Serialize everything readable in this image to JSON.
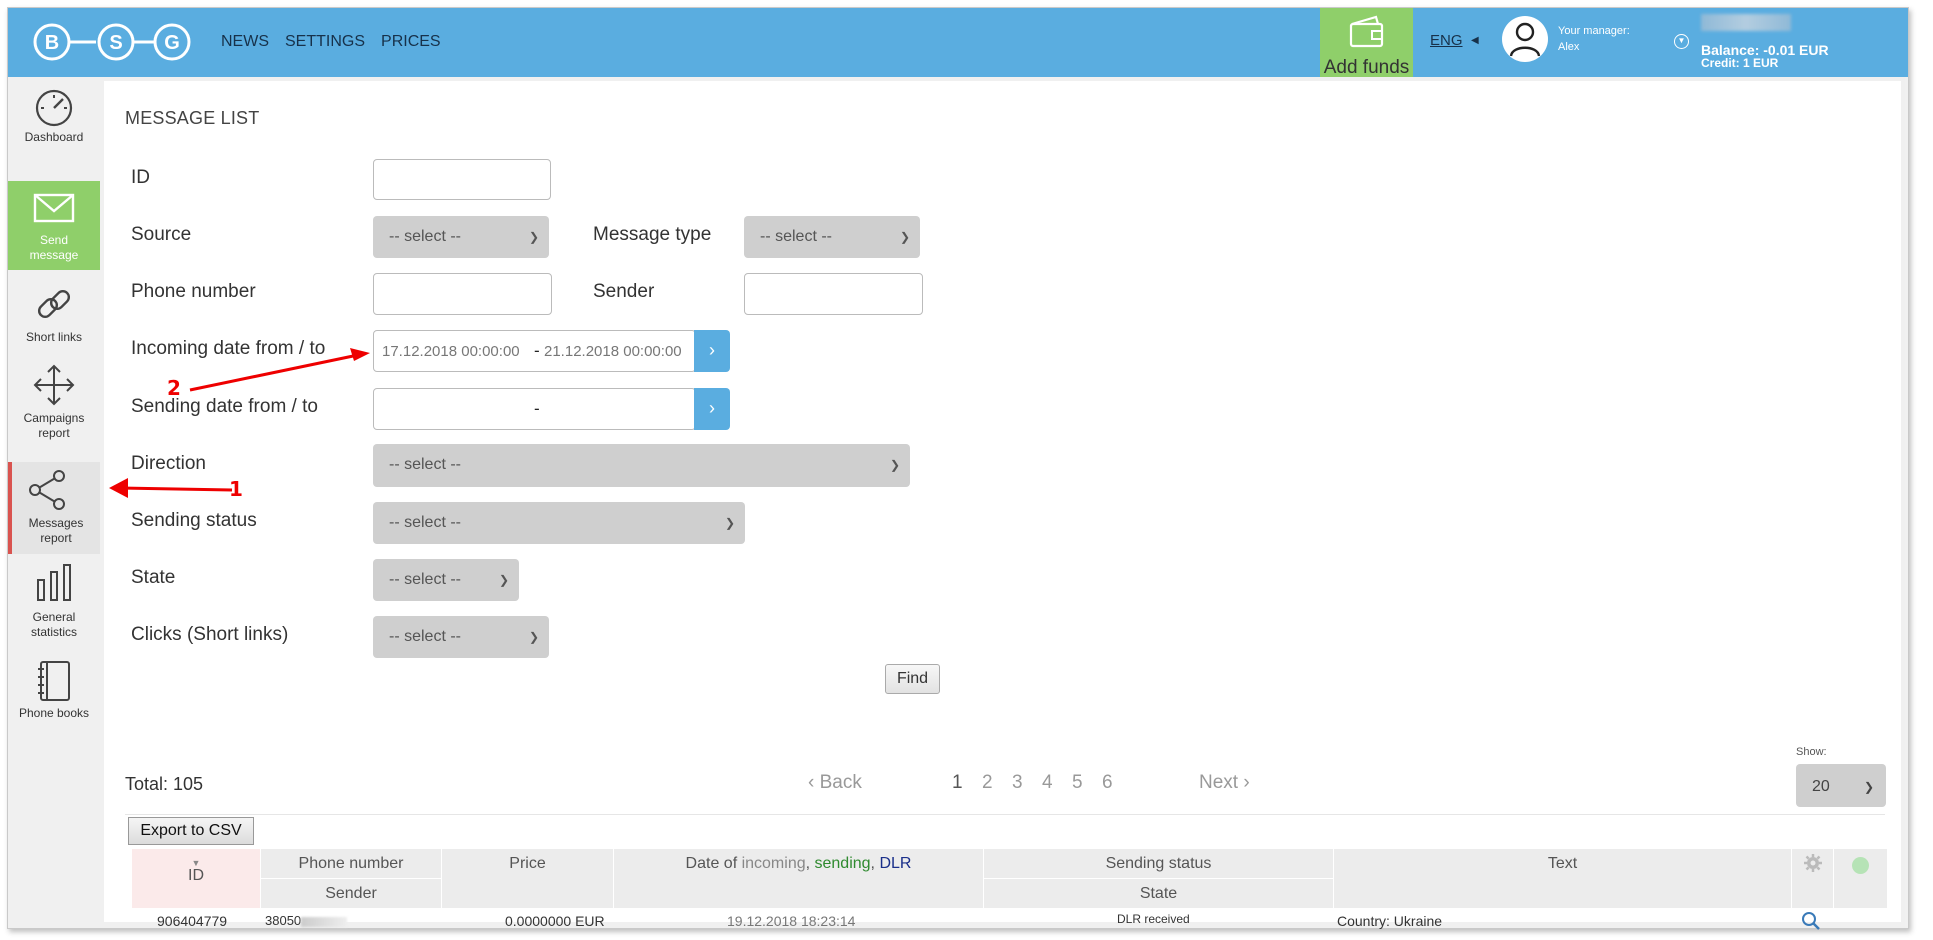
{
  "header": {
    "logo": {
      "letters": [
        "B",
        "S",
        "G"
      ]
    },
    "nav": [
      "NEWS",
      "SETTINGS",
      "PRICES"
    ],
    "add_funds": "Add funds",
    "language": "ENG",
    "manager_label": "Your manager:",
    "manager_name": "Alex",
    "balance": "Balance: -0.01 EUR",
    "credit": "Credit: 1 EUR"
  },
  "sidebar": [
    {
      "label": "Dashboard",
      "icon": "dashboard-gauge-icon"
    },
    {
      "label": "Send message",
      "icon": "envelope-icon"
    },
    {
      "label": "Short links",
      "icon": "link-icon"
    },
    {
      "label": "Campaigns report",
      "icon": "move-arrows-icon"
    },
    {
      "label": "Messages report",
      "icon": "share-icon"
    },
    {
      "label": "General statistics",
      "icon": "bar-chart-icon"
    },
    {
      "label": "Phone books",
      "icon": "notebook-icon"
    }
  ],
  "filters": {
    "title": "MESSAGE LIST",
    "id_label": "ID",
    "source_label": "Source",
    "source_value": "-- select --",
    "message_type_label": "Message type",
    "message_type_value": "-- select --",
    "phone_label": "Phone number",
    "sender_label": "Sender",
    "incoming_label": "Incoming date from / to",
    "incoming_from": "17.12.2018 00:00:00",
    "incoming_sep": "-",
    "incoming_to": "21.12.2018 00:00:00",
    "sending_label": "Sending date from / to",
    "sending_sep": "-",
    "direction_label": "Direction",
    "direction_value": "-- select --",
    "sending_status_label": "Sending status",
    "sending_status_value": "-- select --",
    "state_label": "State",
    "state_value": "-- select --",
    "clicks_label": "Clicks (Short links)",
    "clicks_value": "-- select --",
    "find_button": "Find"
  },
  "results": {
    "total": "Total: 105",
    "back": "Back",
    "pages": [
      "1",
      "2",
      "3",
      "4",
      "5",
      "6"
    ],
    "next": "Next",
    "show_label": "Show:",
    "show_value": "20",
    "export": "Export to CSV"
  },
  "table": {
    "headers": {
      "id": "ID",
      "phone": "Phone number",
      "sender": "Sender",
      "price": "Price",
      "date_prefix": "Date of ",
      "date_incoming": "incoming",
      "date_sep1": ", ",
      "date_sending": "sending",
      "date_sep2": ", ",
      "date_dlr": "DLR",
      "sending_status": "Sending status",
      "state": "State",
      "text": "Text"
    },
    "rows": [
      {
        "id": "906404779",
        "phone": "38050",
        "price": "0.0000000 EUR",
        "date": "19.12.2018 18:23:14",
        "status": "DLR received",
        "text": "Country: Ukraine"
      }
    ]
  },
  "annotations": {
    "arrow1": "1",
    "arrow2": "2"
  },
  "colors": {
    "topbar": "#5aade0",
    "green": "#8fcf6a",
    "active_marker": "#d9534f",
    "date_button": "#5aade0"
  }
}
